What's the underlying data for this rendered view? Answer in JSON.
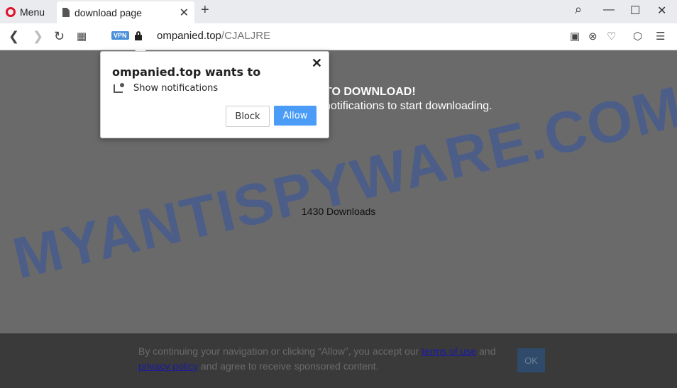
{
  "browser": {
    "menu_label": "Menu",
    "tab_title": "download page",
    "tab_close": "✕",
    "new_tab": "+",
    "win_search": "⌕",
    "win_min": "—",
    "win_max": "☐",
    "win_close": "✕",
    "vpn_label": "VPN",
    "url_domain": "ompanied.top",
    "url_path": "/CJALJRE"
  },
  "page": {
    "heading": "TO DOWNLOAD!",
    "subheading": "notifications to start downloading.",
    "downloads": "1430 Downloads",
    "watermark": "MYANTISPYWARE.COM"
  },
  "cookie": {
    "text_1": "By continuing your navigation or clicking “Allow”, you accept our ",
    "terms_link": "terms of use",
    "text_2": " and ",
    "privacy_link": "privacy policy",
    "text_3": " and agree to receive sponsored content.",
    "ok_label": "OK"
  },
  "popup": {
    "title": "ompanied.top wants to",
    "close": "✕",
    "notification_label": "Show notifications",
    "block_label": "Block",
    "allow_label": "Allow"
  },
  "colors": {
    "allow": "#4a9cf7",
    "opera": "#e0112b",
    "vpn": "#4a90d9"
  }
}
